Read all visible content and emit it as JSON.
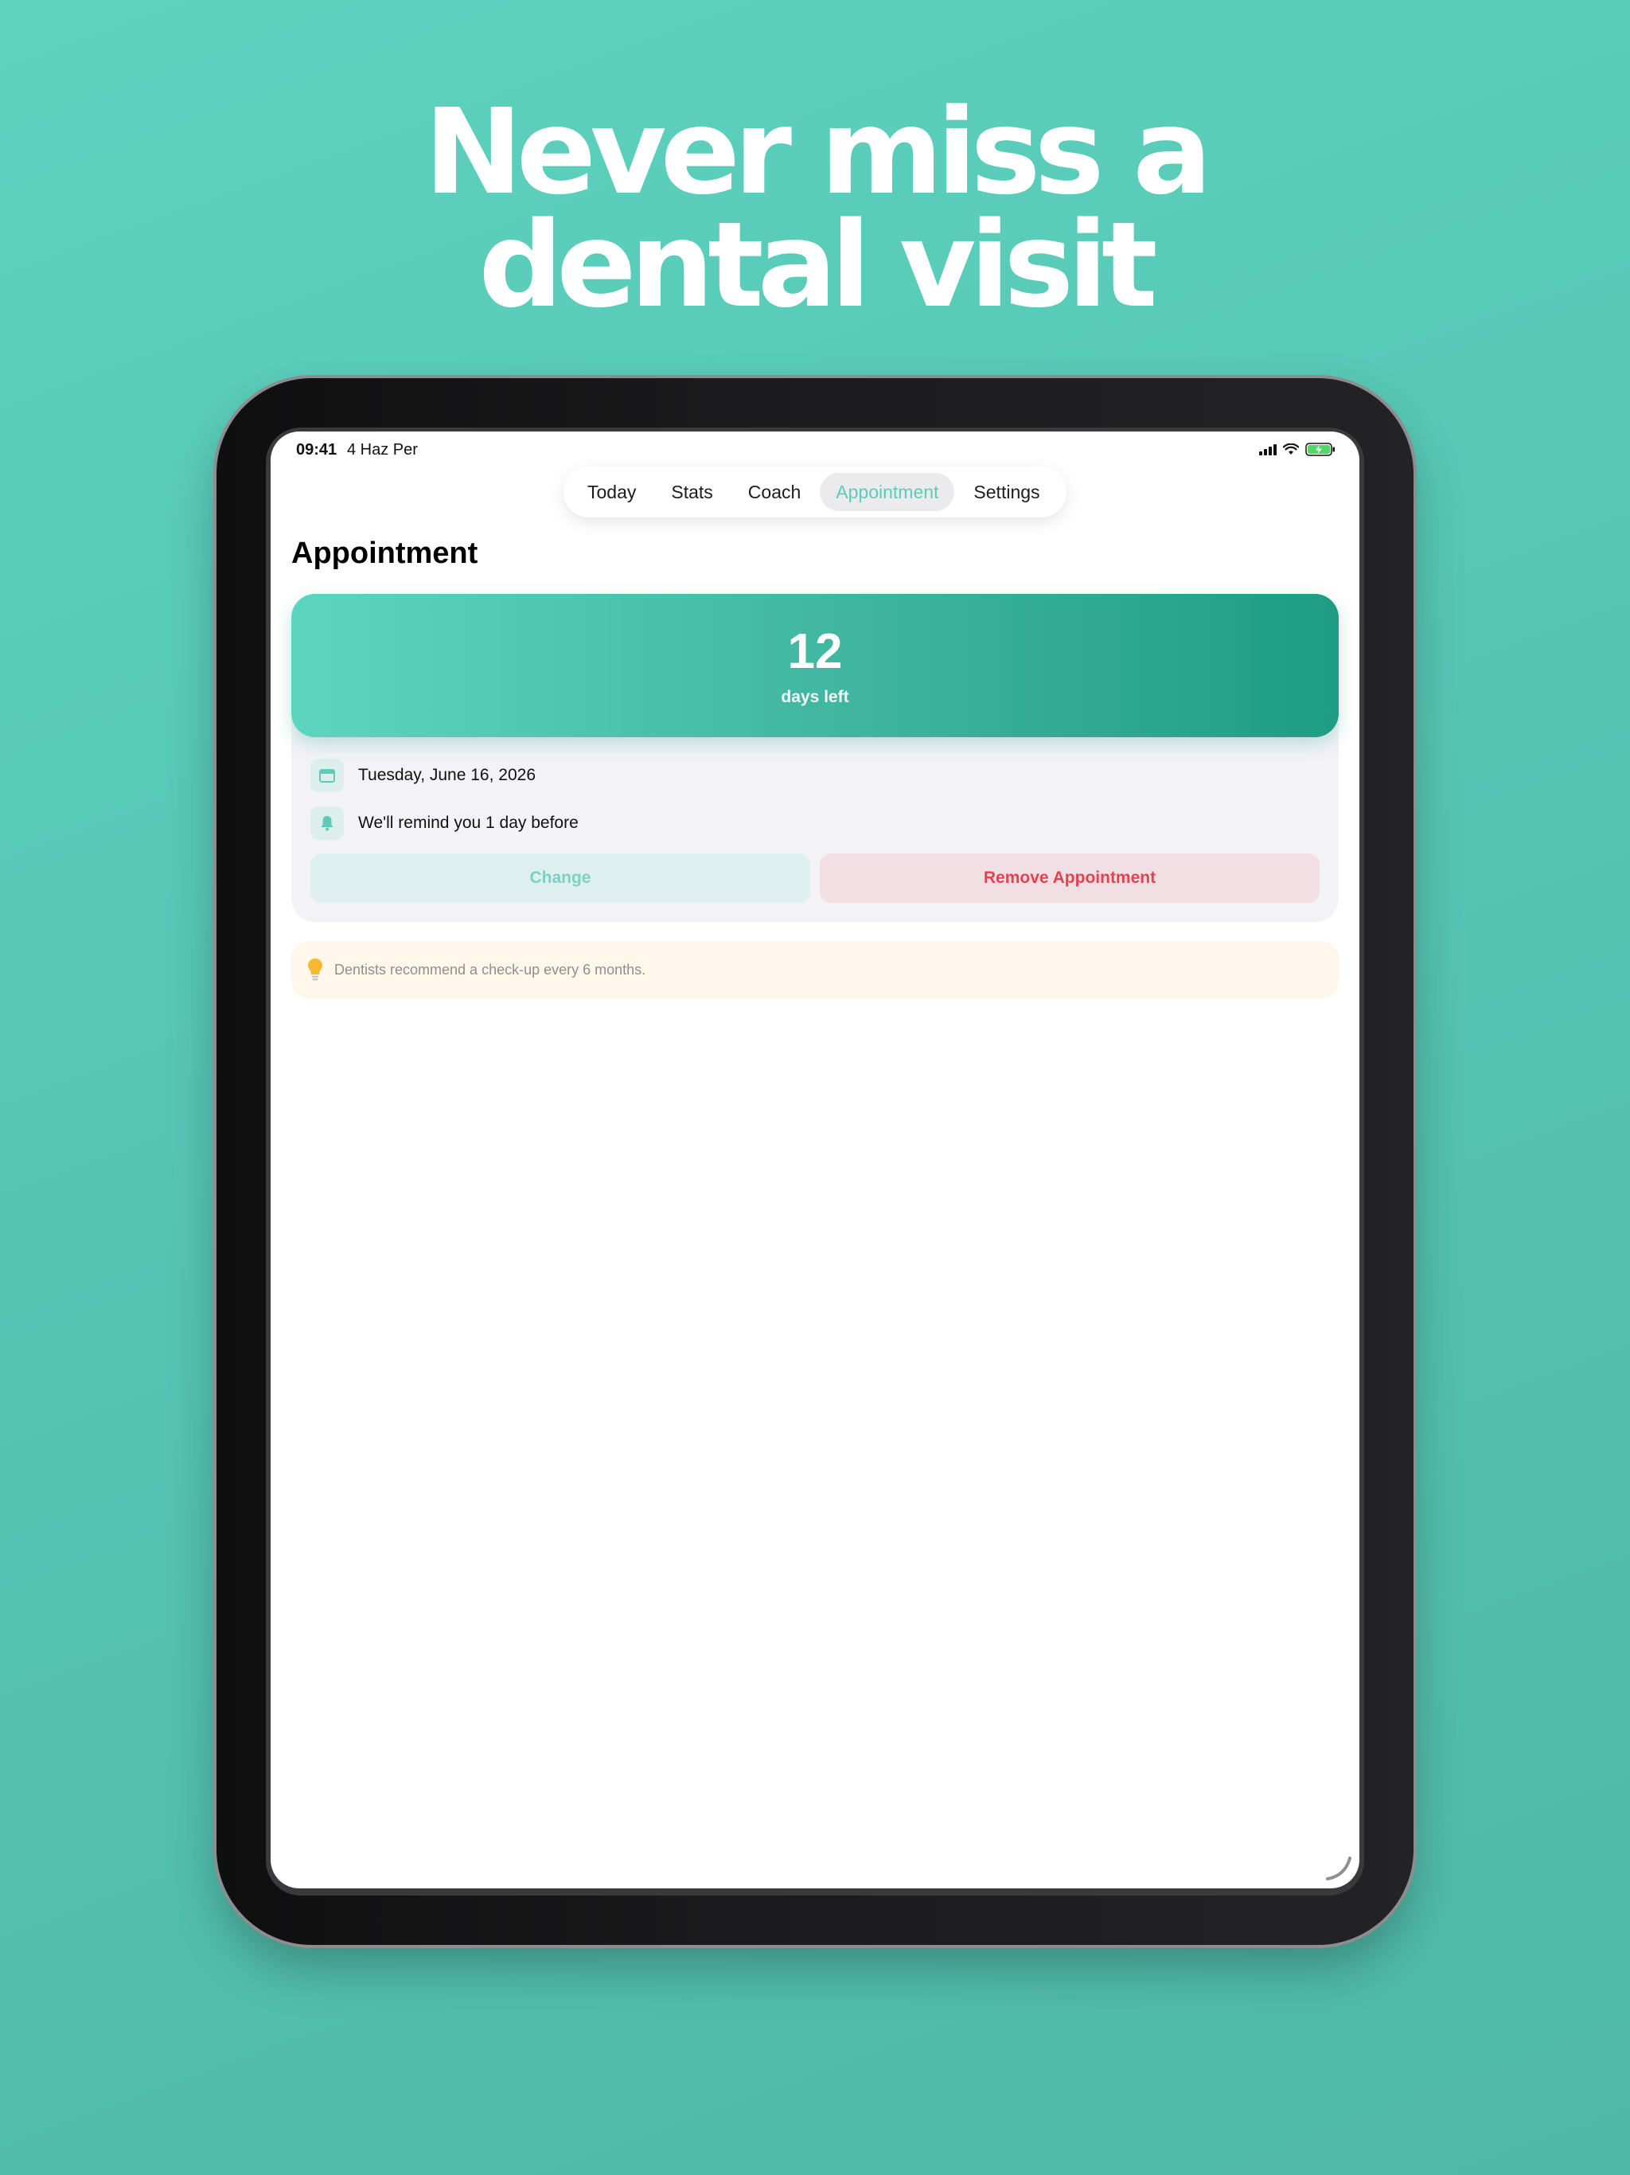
{
  "headline": {
    "line1": "Never miss a",
    "line2": "dental visit"
  },
  "status_bar": {
    "time": "09:41",
    "date": "4 Haz Per"
  },
  "tabs": [
    {
      "label": "Today",
      "active": false
    },
    {
      "label": "Stats",
      "active": false
    },
    {
      "label": "Coach",
      "active": false
    },
    {
      "label": "Appointment",
      "active": true
    },
    {
      "label": "Settings",
      "active": false
    }
  ],
  "page": {
    "title": "Appointment"
  },
  "countdown": {
    "value": "12",
    "label": "days left"
  },
  "details": {
    "date": "Tuesday, June 16, 2026",
    "reminder": "We'll remind you 1 day before"
  },
  "actions": {
    "change": "Change",
    "remove": "Remove Appointment"
  },
  "tip": {
    "text": "Dentists recommend a check-up every 6 months."
  },
  "colors": {
    "background": "#5dd2bf",
    "accent": "#5ccbb8",
    "gradient_end": "#1e9c84",
    "danger": "#e5424f",
    "tip_bg": "#fef7ea"
  }
}
